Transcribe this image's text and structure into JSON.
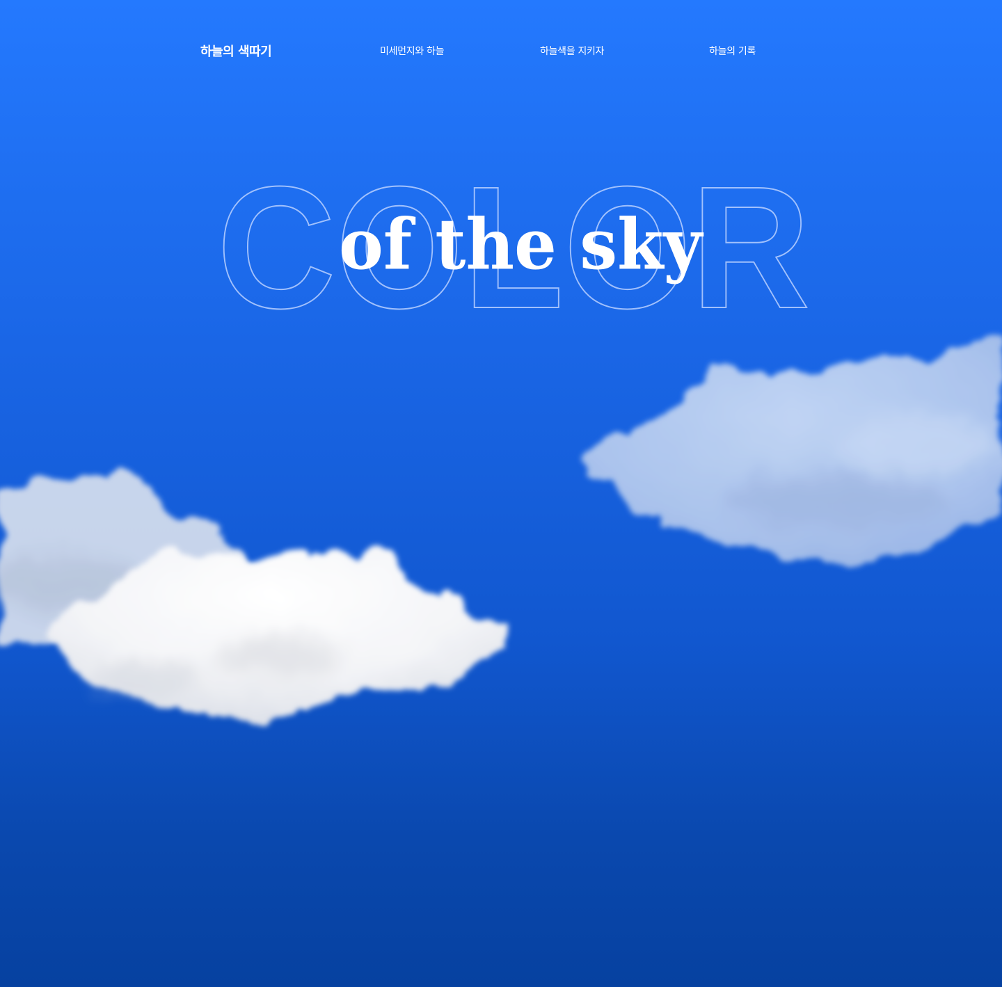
{
  "nav": {
    "logo": "하늘의 색따기",
    "links": [
      {
        "label": "미세먼지와 하늘"
      },
      {
        "label": "하늘색을 지키자"
      },
      {
        "label": "하늘의 기록"
      }
    ]
  },
  "hero": {
    "outline_word": "COLOR",
    "script_word": "of the sky"
  },
  "colors": {
    "sky_top": "#2479fe",
    "sky_bottom": "#0641a0",
    "text": "#ffffff",
    "outline": "#b9d0ff"
  }
}
